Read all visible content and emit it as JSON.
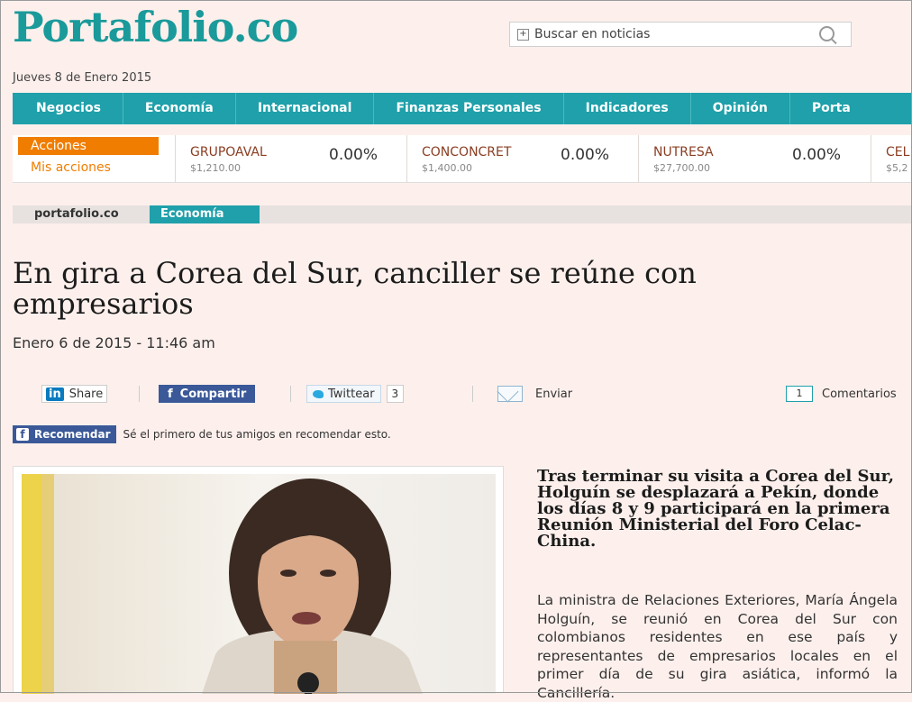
{
  "header": {
    "logo": "Portafolio.co",
    "search_placeholder": "Buscar en noticias",
    "date": "Jueves 8 de Enero 2015"
  },
  "nav": {
    "items": [
      "Negocios",
      "Economía",
      "Internacional",
      "Finanzas Personales",
      "Indicadores",
      "Opinión",
      "Porta"
    ]
  },
  "ticker": {
    "tab_active": "Acciones",
    "tab_inactive": "Mis acciones",
    "stocks": [
      {
        "name": "GRUPOAVAL",
        "price": "$1,210.00",
        "change": "0.00%"
      },
      {
        "name": "CONCONCRET",
        "price": "$1,400.00",
        "change": "0.00%"
      },
      {
        "name": "NUTRESA",
        "price": "$27,700.00",
        "change": "0.00%"
      },
      {
        "name": "CEL",
        "price": "$5,2",
        "change": ""
      }
    ]
  },
  "breadcrumb": {
    "home": "portafolio.co",
    "section": "Economía"
  },
  "article": {
    "title": "En gira a Corea del Sur, canciller se reúne con empresarios",
    "date": "Enero 6 de 2015 - 11:46 am",
    "subhead": "Tras terminar su visita a Corea del Sur, Holguín se desplazará a Pekín, donde los días 8 y 9 participará en la primera Reunión Ministerial del Foro Celac-China.",
    "body": "La ministra de Relaciones Exteriores, María Ángela Holguín, se reunió en Corea del Sur con colombianos residentes en ese país y representantes de empresarios locales en el primer día de su gira asiática, informó la Cancillería."
  },
  "social": {
    "linkedin_logo": "in",
    "linkedin_label": "Share",
    "facebook_label": "Compartir",
    "twitter_label": "Twittear",
    "twitter_count": "3",
    "email_label": "Enviar",
    "comments_count": "1",
    "comments_label": "Comentarios",
    "recommend_label": "Recomendar",
    "recommend_text": "Sé el primero de tus amigos en recomendar esto."
  },
  "colors": {
    "brand": "#1fa0aa",
    "accent": "#f07d00",
    "facebook": "#3b5998",
    "background": "#fdf0ec"
  }
}
